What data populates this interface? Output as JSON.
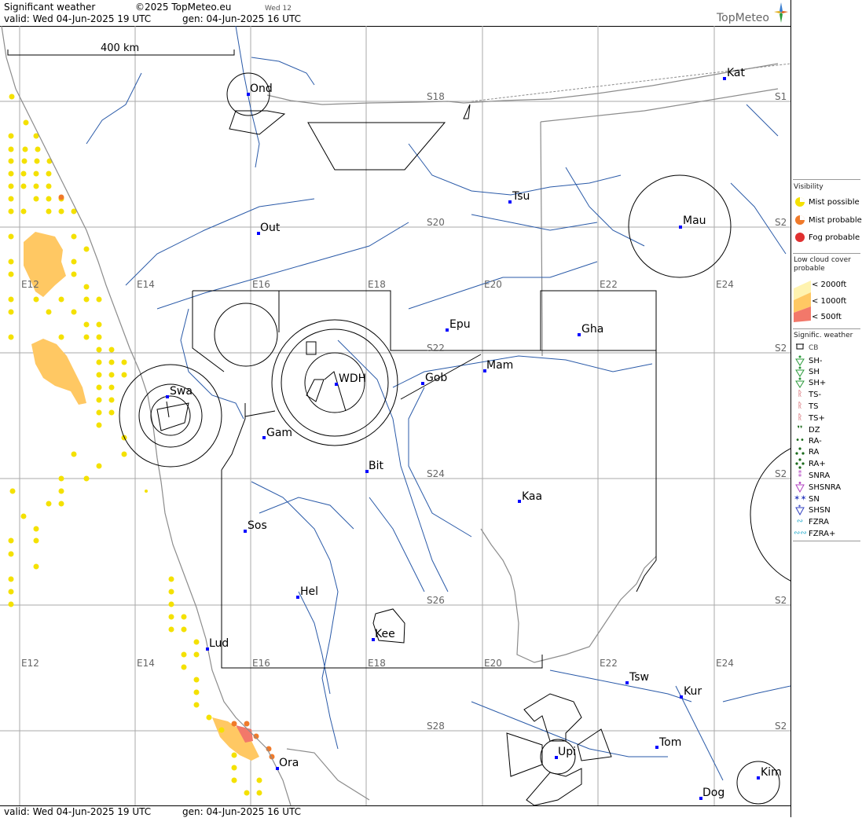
{
  "header": {
    "product": "Significant weather",
    "copyright": "©2025 TopMeteo.eu",
    "day_tag": "Wed 12",
    "valid": "valid:  Wed  04-Jun-2025  19 UTC",
    "generated": "gen: 04-Jun-2025 16 UTC",
    "brand": "TopMeteo"
  },
  "footer": {
    "valid": "valid:  Wed  04-Jun-2025  19 UTC",
    "generated": "gen: 04-Jun-2025 16 UTC"
  },
  "map": {
    "scale_label": "400 km",
    "latitudes": {
      "s18_left": "S18",
      "s18_right": "S1",
      "s20": "S20",
      "s20_right": "S2",
      "s22": "S22",
      "s22_right": "S2",
      "s24": "S24",
      "s24_right": "S2",
      "s26": "S26",
      "s26_right": "S2",
      "s28": "S28",
      "s28_right": "S2"
    },
    "longitudes_upper": [
      "E12",
      "E14",
      "E16",
      "E18",
      "E20",
      "E22",
      "E24"
    ],
    "longitudes_lower": [
      "E12",
      "E14",
      "E16",
      "E18",
      "E20",
      "E22",
      "E24"
    ],
    "stations": {
      "ond": "Ond",
      "kat": "Kat",
      "tsu": "Tsu",
      "mau": "Mau",
      "out": "Out",
      "epu": "Epu",
      "gha": "Gha",
      "mam": "Mam",
      "gob": "Gob",
      "wdh": "WDH",
      "swa": "Swa",
      "gam": "Gam",
      "bit": "Bit",
      "kaa": "Kaa",
      "sos": "Sos",
      "hel": "Hel",
      "kee": "Kee",
      "lud": "Lud",
      "tsw": "Tsw",
      "kur": "Kur",
      "tom": "Tom",
      "upi": "Upi",
      "ora": "Ora",
      "kim": "Kim",
      "dog": "Dog"
    },
    "colors": {
      "border": "#8c8c8c",
      "river": "#2a5aa8",
      "grid": "#aaaaaa",
      "mist": "#f4e100",
      "low_cloud": "#ffc863",
      "mist_probable": "#f07a2a",
      "station": "#0000ff"
    }
  },
  "legend": {
    "visibility_title": "Visibility",
    "mist_possible": "Mist possible",
    "mist_probable": "Mist probable",
    "fog_probable": "Fog probable",
    "low_cloud_title": "Low cloud cover probable",
    "lc_2000": "< 2000ft",
    "lc_1000": "< 1000ft",
    "lc_500": "<   500ft",
    "sigwx_title": "Signific. weather",
    "cb": "CB",
    "sh_minus": "SH-",
    "sh": "SH",
    "sh_plus": "SH+",
    "ts_minus": "TS-",
    "ts": "TS",
    "ts_plus": "TS+",
    "dz": "DZ",
    "ra_minus": "RA-",
    "ra": "RA",
    "ra_plus": "RA+",
    "snra": "SNRA",
    "shsnra": "SHSNRA",
    "sn": "SN",
    "shsn": "SHSN",
    "fzra": "FZRA",
    "fzra_plus": "FZRA+",
    "icons": [
      "cb-icon",
      "shower-light-icon",
      "shower-icon",
      "shower-heavy-icon",
      "thunderstorm-light-icon",
      "thunderstorm-icon",
      "thunderstorm-heavy-icon",
      "drizzle-icon",
      "rain-light-icon",
      "rain-icon",
      "rain-heavy-icon",
      "snow-rain-icon",
      "snow-rain-shower-icon",
      "snow-icon",
      "snow-shower-icon",
      "freezing-rain-icon",
      "freezing-rain-heavy-icon"
    ]
  }
}
